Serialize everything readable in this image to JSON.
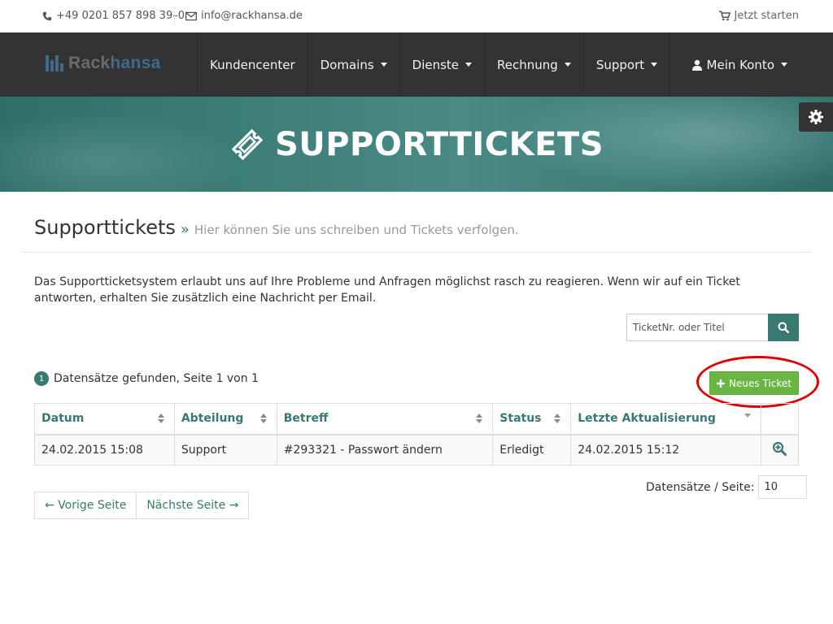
{
  "topbar": {
    "phone": "+49 0201 857 898 39–0",
    "email": "info@rackhansa.de",
    "start": "Jetzt starten"
  },
  "logo": {
    "part1": "Rack",
    "part2": "hansa"
  },
  "nav": {
    "items": [
      "Kundencenter",
      "Domains",
      "Dienste",
      "Rechnung",
      "Support"
    ],
    "account": "Mein Konto"
  },
  "hero": {
    "title": "SUPPORTTICKETS"
  },
  "header": {
    "title": "Supporttickets",
    "raquo": "»",
    "subtitle": "Hier können Sie uns schreiben und Tickets verfolgen."
  },
  "intro": "Das Supportticketsystem erlaubt uns auf Ihre Probleme und Anfragen möglichst rasch zu reagieren. Wenn wir auf ein Ticket antworten, erhalten Sie zusätzlich eine Nachricht per Email.",
  "search": {
    "placeholder": "TicketNr. oder Titel"
  },
  "results": {
    "badge": "1",
    "text": "Datensätze gefunden, Seite 1 von 1"
  },
  "new_ticket_label": "Neues Ticket",
  "table": {
    "headers": [
      "Datum",
      "Abteilung",
      "Betreff",
      "Status",
      "Letzte Aktualisierung"
    ],
    "rows": [
      {
        "datum": "24.02.2015 15:08",
        "abteilung": "Support",
        "betreff": "#293321 - Passwort ändern",
        "status": "Erledigt",
        "update": "24.02.2015 15:12"
      }
    ]
  },
  "per_page": {
    "label": "Datensätze / Seite:",
    "value": "10"
  },
  "pager": {
    "prev": "← Vorige Seite",
    "next": "Nächste Seite →"
  },
  "colors": {
    "accent": "#3a7872",
    "nav_bg": "#333333",
    "success": "#6bb544",
    "highlight": "#e00000"
  }
}
